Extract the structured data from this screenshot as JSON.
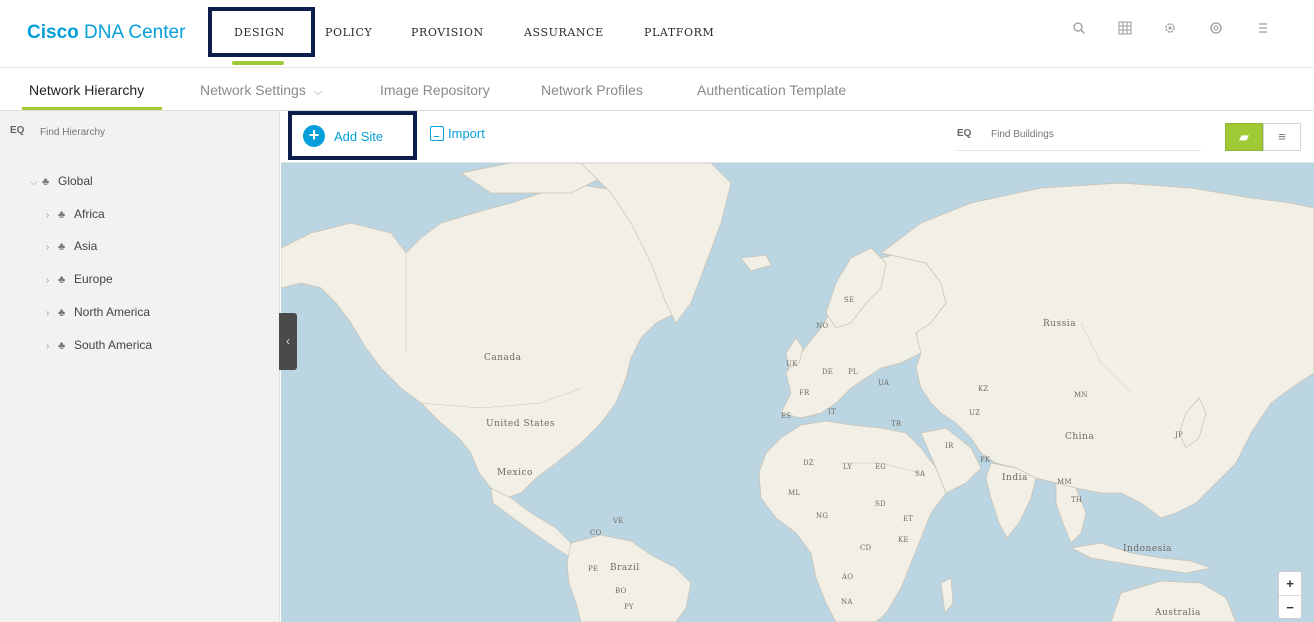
{
  "header": {
    "brand_bold": "Cisco",
    "brand_rest": "DNA Center",
    "nav": [
      "DESIGN",
      "POLICY",
      "PROVISION",
      "ASSURANCE",
      "PLATFORM"
    ],
    "active_nav": "DESIGN",
    "icons": [
      "search-icon",
      "apps-grid-icon",
      "settings-icon",
      "help-icon",
      "menu-icon"
    ]
  },
  "subtabs": [
    {
      "label": "Network Hierarchy",
      "active": true
    },
    {
      "label": "Network Settings",
      "dropdown": true
    },
    {
      "label": "Image Repository"
    },
    {
      "label": "Network Profiles"
    },
    {
      "label": "Authentication Template"
    }
  ],
  "dropdown_glyph": "⌵",
  "hierarchy": {
    "search_placeholder": "Find Hierarchy",
    "tree": [
      {
        "label": "Global",
        "level": 0,
        "expanded": true
      },
      {
        "label": "Africa",
        "level": 1
      },
      {
        "label": "Asia",
        "level": 1
      },
      {
        "label": "Europe",
        "level": 1
      },
      {
        "label": "North America",
        "level": 1
      },
      {
        "label": "South America",
        "level": 1
      }
    ]
  },
  "toolbar": {
    "add_site_label": "Add Site",
    "import_label": "Import",
    "building_search_placeholder": "Find Buildings",
    "search_prefix": "EQ",
    "map_view_active": true
  },
  "map": {
    "labels": {
      "russia": "Russia",
      "canada": "Canada",
      "united_states": "United States",
      "mexico": "Mexico",
      "china": "China",
      "india": "India",
      "indonesia": "Indonesia",
      "brazil": "Brazil",
      "australia": "Australia",
      "mn": "MN",
      "kz": "KZ",
      "jp": "JP",
      "uz": "UZ",
      "ir": "IR",
      "pk": "PK",
      "tr": "TR",
      "sa": "SA",
      "eg": "EG",
      "ly": "LY",
      "dz": "DZ",
      "ml": "ML",
      "ng": "NG",
      "sd": "SD",
      "et": "ET",
      "cd": "CD",
      "ke": "KE",
      "ao": "AO",
      "na": "NA",
      "se": "SE",
      "no": "NO",
      "uk": "UK",
      "fr": "FR",
      "de": "DE",
      "pl": "PL",
      "ua": "UA",
      "es": "ES",
      "it": "IT",
      "co": "CO",
      "ve": "VE",
      "pe": "PE",
      "bo": "BO",
      "py": "PY",
      "mm": "MM",
      "th": "TH"
    },
    "colors": {
      "water": "#bcd5e2",
      "land": "#f2efe6",
      "border": "#b9b3a6"
    },
    "zoom_in": "+",
    "zoom_out": "−"
  },
  "colors": {
    "accent_blue": "#049fd9",
    "accent_green": "#9fca35",
    "highlight_box": "#0d1e4c"
  }
}
